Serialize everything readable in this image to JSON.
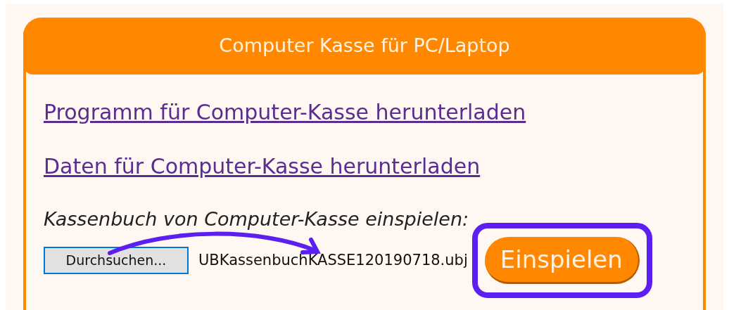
{
  "card": {
    "title": "Computer Kasse für PC/Laptop"
  },
  "links": [
    "Programm für Computer-Kasse herunterladen",
    "Daten für Computer-Kasse herunterladen"
  ],
  "upload": {
    "label": "Kassenbuch von Computer-Kasse einspielen:",
    "browse_button": "Durchsuchen...",
    "filename": "UBKassenbuchKASSE120190718.ubj",
    "submit_button": "Einspielen"
  }
}
